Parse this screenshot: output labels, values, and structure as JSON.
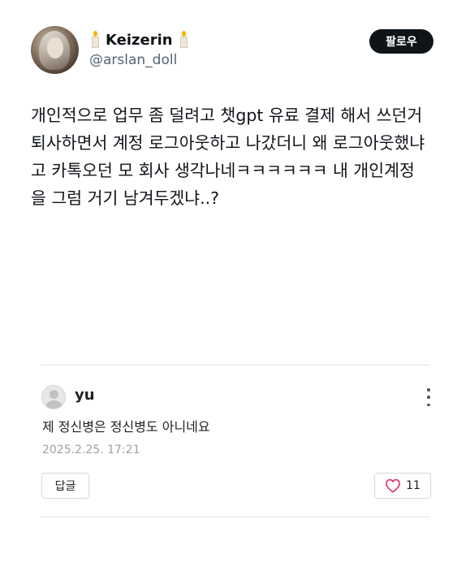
{
  "profile": {
    "display_name": "Keizerin",
    "handle": "@arslan_doll",
    "name_decoration_icon": "candle-icon"
  },
  "follow_button": {
    "label": "팔로우"
  },
  "tweet": {
    "lines": [
      "개인적으로 업무 좀 덜려고 챗gpt 유료 결제 해서 쓰던거",
      "퇴사하면서 계정 로그아웃하고 나갔더니 왜 로그아웃했냐",
      "고 카톡오던 모 회사 생각나네ㅋㅋㅋㅋㅋㅋ 내 개인계정",
      "을 그럼 거기 남겨두겠냐..?"
    ]
  },
  "comment": {
    "author": "yu",
    "text": "제 정신병은 정신병도 아니네요",
    "date": "2025.2.25. 17:21",
    "reply_label": "답글",
    "like_count": "11"
  }
}
